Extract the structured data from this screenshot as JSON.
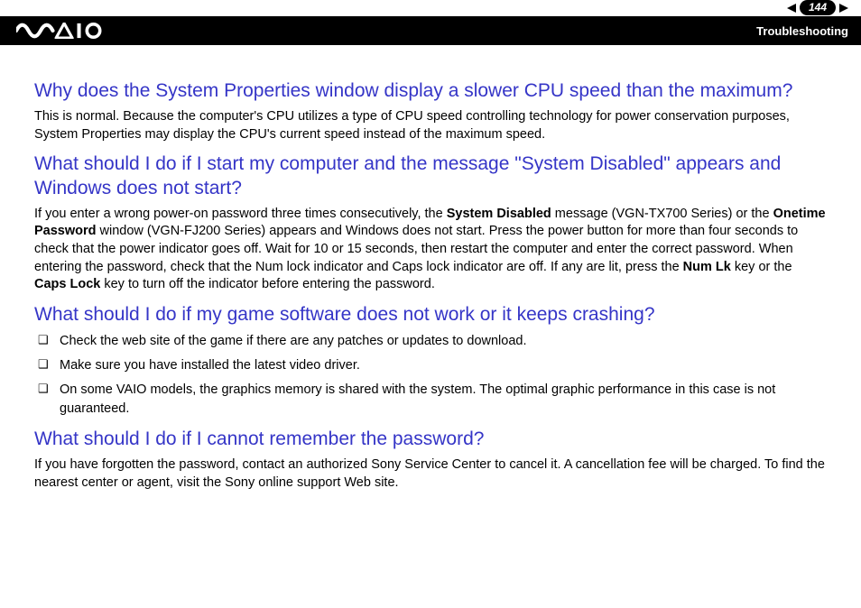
{
  "header": {
    "page_number": "144",
    "section": "Troubleshooting",
    "logo_alt": "VAIO"
  },
  "content": {
    "q1": "Why does the System Properties window display a slower CPU speed than the maximum?",
    "a1": "This is normal. Because the computer's CPU utilizes a type of CPU speed controlling technology for power conservation purposes, System Properties may display the CPU's current speed instead of the maximum speed.",
    "q2": "What should I do if I start my computer and the message \"System Disabled\" appears and Windows does not start?",
    "a2_pre": "If you enter a wrong power-on password three times consecutively, the ",
    "a2_b1": "System Disabled",
    "a2_mid1": " message (VGN-TX700 Series) or the ",
    "a2_b2": "Onetime Password",
    "a2_mid2": " window (VGN-FJ200 Series) appears and Windows does not start. Press the power button for more than four seconds to check that the power indicator goes off. Wait for 10 or 15 seconds, then restart the computer and enter the correct password. When entering the password, check that the Num lock indicator and Caps lock indicator are off. If any are lit, press the ",
    "a2_b3": "Num Lk",
    "a2_mid3": " key or the ",
    "a2_b4": "Caps Lock",
    "a2_post": " key to turn off the indicator before entering the password.",
    "q3": "What should I do if my game software does not work or it keeps crashing?",
    "bullets": [
      "Check the web site of the game if there are any patches or updates to download.",
      "Make sure you have installed the latest video driver.",
      "On some VAIO models, the graphics memory is shared with the system. The optimal graphic performance in this case is not guaranteed."
    ],
    "q4": "What should I do if I cannot remember the password?",
    "a4": "If you have forgotten the password, contact an authorized Sony Service Center to cancel it. A cancellation fee will be charged. To find the nearest center or agent, visit the Sony online support Web site."
  }
}
